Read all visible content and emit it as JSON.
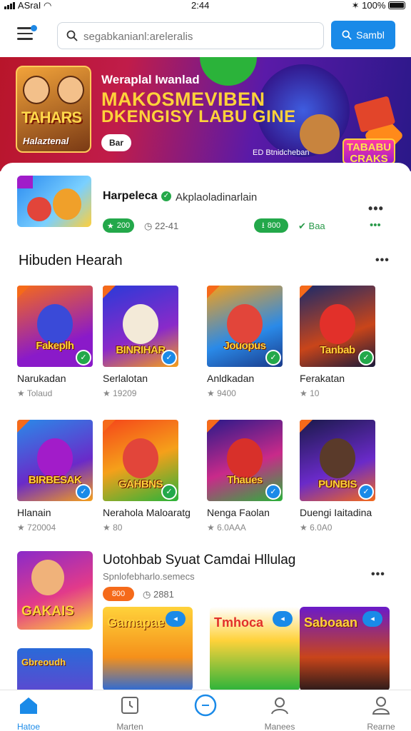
{
  "status_bar": {
    "carrier": "ASraI",
    "time": "2:44",
    "battery": "100%"
  },
  "search": {
    "placeholder": "segabkanianl:areleralis",
    "button_label": "Sambl"
  },
  "banner": {
    "subtitle": "Weraplal Iwanlad",
    "headline_1": "MAKOSMEVIBEN",
    "headline_2": "DKENGISY LABU GINE",
    "cta_label": "Bar",
    "small_text": "ED Btnidcheban",
    "art_title": "TAHARS",
    "art_subtitle": "Halaztenal",
    "logo_text": "TABABU CRAKS"
  },
  "featured": {
    "title": "Harpeleca",
    "subtitle": "Akplaoladinarlain",
    "pill_1": "200",
    "meta_1": "22-41",
    "pill_2": "800",
    "meta_2": "Baa"
  },
  "section_1": {
    "title": "Hibuden Hearah",
    "games": [
      {
        "thumb_title": "Fakeplh",
        "name": "Narukadan",
        "stat": "Tolaud",
        "badge": "green",
        "bg": "linear-gradient(160deg,#f56a1a,#8a1ac9 70%)",
        "hero": "#3a4ad8"
      },
      {
        "thumb_title": "BINRIHAR",
        "name": "Serlalotan",
        "stat": "19209",
        "badge": "blue",
        "bg": "linear-gradient(160deg,#2a3ad8,#8a2ac9 60%,#f5a01a)",
        "hero": "#f3ead8"
      },
      {
        "thumb_title": "Jouopus",
        "name": "Anldkadan",
        "stat": "9400",
        "badge": "green",
        "bg": "linear-gradient(160deg,#f5a01a,#2a8ae8 60%,#1a3a8a)",
        "hero": "#e2453a"
      },
      {
        "thumb_title": "Tanbab",
        "name": "Ferakatan",
        "stat": "10",
        "badge": "green",
        "bg": "linear-gradient(160deg,#1a2a6a,#c9451a 60%,#1a1a3a)",
        "hero": "#e2302a"
      }
    ]
  },
  "section_2": {
    "games": [
      {
        "thumb_title": "BIRBESAK",
        "name": "Hlanain",
        "stat": "720004",
        "badge": "blue",
        "bg": "linear-gradient(160deg,#2a8ae8,#6a2ac9 60%,#f5a01a)",
        "hero": "#a21cc9"
      },
      {
        "thumb_title": "GAHBNS",
        "name": "Nerahola Maloaratg",
        "stat": "80",
        "badge": "green",
        "bg": "linear-gradient(160deg,#f5451a,#f5a01a 50%,#2ab33a)",
        "hero": "#e2453a"
      },
      {
        "thumb_title": "Thaues",
        "name": "Nenga Faolan",
        "stat": "6.0AAA",
        "badge": "blue",
        "bg": "linear-gradient(160deg,#2a1a8a,#c92a8a 55%,#2ab33a)",
        "hero": "#d8302a"
      },
      {
        "thumb_title": "PUNBIS",
        "name": "Duengi Iaitadina",
        "stat": "6.0A0",
        "badge": "blue",
        "bg": "linear-gradient(160deg,#1a1a4a,#6a2ac9 60%,#f56a1a)",
        "hero": "#5a3a2a"
      }
    ]
  },
  "section_3": {
    "title": "Uotohbab Syuat Camdai Hllulag",
    "subtitle": "Spnlofebharlo.semecs",
    "pill": "800",
    "meta": "2881",
    "thumb_title": "GAKAIS",
    "minis": [
      {
        "title": "Gamapae",
        "play": "◂"
      },
      {
        "title": "Tmhoca",
        "play": "◂"
      },
      {
        "title": "Saboaan",
        "play": "◂"
      }
    ],
    "bottom_thumb_title": "Gbreoudh"
  },
  "tabs": [
    {
      "label": "Hatoe",
      "icon": "home-icon",
      "active": true
    },
    {
      "label": "Marten",
      "icon": "clock-icon",
      "active": false
    },
    {
      "label": "",
      "icon": "center-circle-icon",
      "active": false
    },
    {
      "label": "Manees",
      "icon": "person-icon",
      "active": false
    },
    {
      "label": "Rearne",
      "icon": "profile-icon",
      "active": false
    }
  ],
  "colors": {
    "accent": "#1a8ae8",
    "green": "#23a84a",
    "orange": "#f56a1a"
  }
}
